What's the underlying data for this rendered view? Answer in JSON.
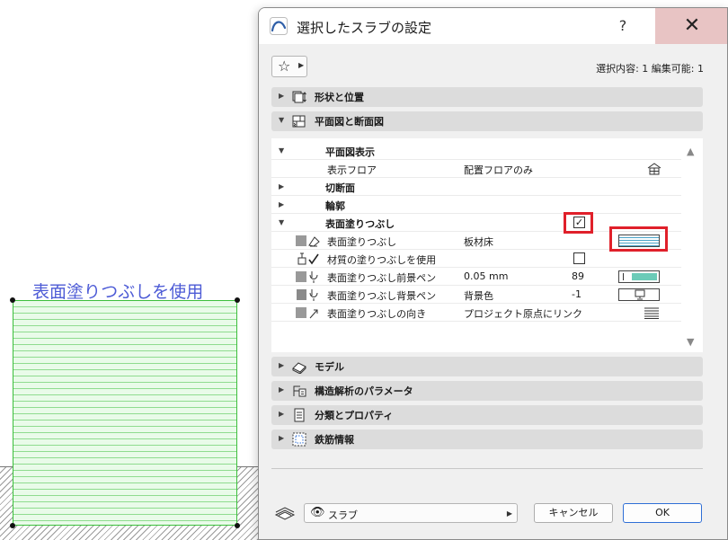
{
  "canvas": {
    "slab_label": "表面塗りつぶしを使用"
  },
  "dialog": {
    "title": "選択したスラブの設定",
    "help_label": "?",
    "close_label": "✕",
    "selection_info": "選択内容: 1 編集可能: 1",
    "sections": {
      "shape": "形状と位置",
      "plan": "平面図と断面図",
      "model": "モデル",
      "structural": "構造解析のパラメータ",
      "classification": "分類とプロパティ",
      "rebar": "鉄筋情報"
    },
    "rows": {
      "plan_display": {
        "label": "平面図表示"
      },
      "show_floor": {
        "label": "表示フロア",
        "value": "配置フロアのみ"
      },
      "cut": {
        "label": "切断面"
      },
      "outline": {
        "label": "輪郭"
      },
      "cover_fill": {
        "label": "表面塗りつぶし",
        "checked": true
      },
      "cover_fill_type": {
        "label": "表面塗りつぶし",
        "value": "板材床"
      },
      "use_material_fill": {
        "label": "材質の塗りつぶしを使用",
        "checked": false
      },
      "fg_pen": {
        "label": "表面塗りつぶし前景ペン",
        "value": "0.05 mm",
        "number": "89"
      },
      "bg_pen": {
        "label": "表面塗りつぶし背景ペン",
        "value": "背景色",
        "number": "-1"
      },
      "orientation": {
        "label": "表面塗りつぶしの向き",
        "value": "プロジェクト原点にリンク"
      }
    },
    "footer": {
      "view_label": "スラブ",
      "cancel_label": "キャンセル",
      "ok_label": "OK"
    }
  },
  "colors": {
    "slab_hatch": "#8fdc8f",
    "slab_border": "#3cbf3c",
    "label_blue": "#4d5bd6",
    "highlight_red": "#e0202a",
    "fg_pen_teal": "#6ccbb8",
    "close_hover": "#e8c4c4"
  }
}
